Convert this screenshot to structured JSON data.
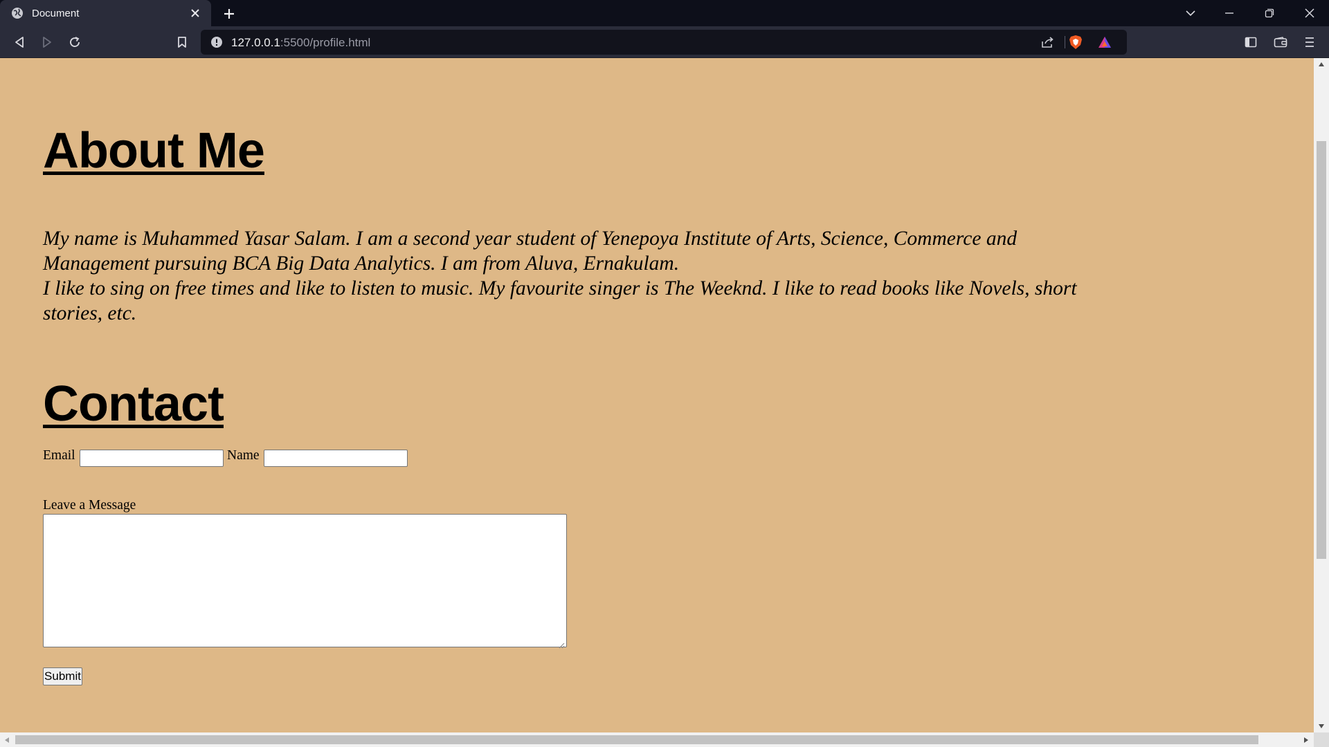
{
  "browser": {
    "tab": {
      "title": "Document",
      "favicon": "globe-icon",
      "close_icon": "close-icon"
    },
    "new_tab_icon": "plus-icon",
    "window_controls": [
      "chevron-down-icon",
      "minimize-icon",
      "restore-icon",
      "close-icon"
    ],
    "toolbar": {
      "back_icon": "back-arrow-icon",
      "forward_icon": "forward-arrow-icon",
      "reload_icon": "reload-icon",
      "bookmark_icon": "bookmark-icon",
      "address": {
        "host": "127.0.0.1",
        "path": ":5500/profile.html",
        "site_info_icon": "info-icon"
      },
      "share_icon": "share-icon",
      "shield_icon": "brave-shield-icon",
      "rewards_icon": "brave-rewards-icon",
      "sidebar_icon": "sidebar-icon",
      "wallet_icon": "wallet-icon",
      "menu_icon": "hamburger-menu-icon"
    }
  },
  "page": {
    "background_color": "#deb887",
    "about": {
      "heading": "About Me",
      "line1": "My name is Muhammed Yasar Salam. I am a second year student of Yenepoya Institute of Arts, Science, Commerce and Management pursuing BCA Big Data Analytics. I am from Aluva, Ernakulam.",
      "line2": "I like to sing on free times and like to listen to music. My favourite singer is The Weeknd. I like to read books like Novels, short stories, etc."
    },
    "contact": {
      "heading": "Contact",
      "email_label": "Email",
      "email_value": "",
      "name_label": "Name",
      "name_value": "",
      "message_label": "Leave a Message",
      "message_value": "",
      "submit_label": "Submit"
    }
  }
}
